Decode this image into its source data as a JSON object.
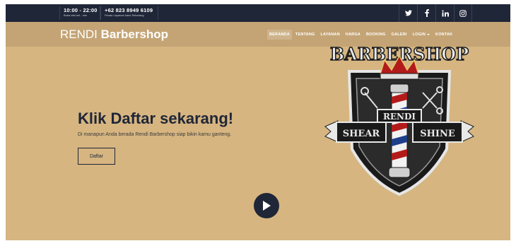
{
  "topbar": {
    "hours": "10:00 - 22:00",
    "hours_note": "Buka dari sel - min",
    "phone": "+62 823 8949 6109",
    "phone_note": "Pesan Layanan kami Sekarang",
    "social": [
      "twitter-icon",
      "facebook-icon",
      "linkedin-icon",
      "instagram-icon"
    ]
  },
  "nav": {
    "brand_light": "RENDI",
    "brand_bold": "Barbershop",
    "items": [
      "BERANDA",
      "TENTANG",
      "LAYANAN",
      "HARGA",
      "BOOKING",
      "GALERI",
      "LOGIN",
      "KONTAK"
    ]
  },
  "hero": {
    "headline": "Klik Daftar sekarang!",
    "subtext": "Di manapun Anda berada Rendi Barbershop siap bikin kamu ganteng.",
    "button": "Daftar"
  },
  "logo": {
    "title": "BARBERSHOP",
    "name": "RENDI",
    "left_word": "SHEAR",
    "right_word": "SHINE"
  },
  "colors": {
    "navy": "#1f2637",
    "gold": "#c4a475",
    "sand": "#d6b581",
    "red": "#b31b1b"
  }
}
